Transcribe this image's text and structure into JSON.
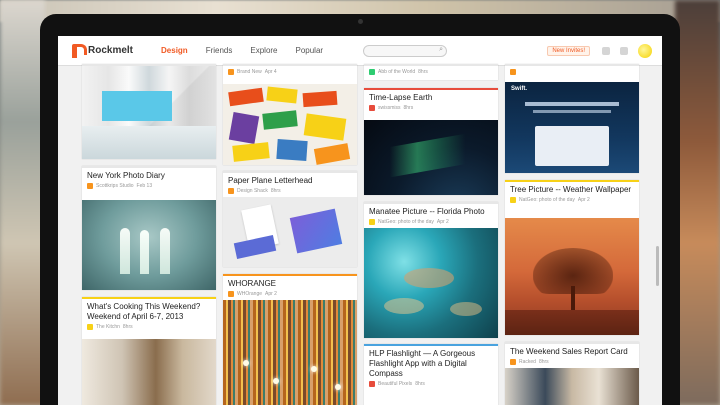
{
  "nav": {
    "brand": "Rockmelt",
    "links": [
      "Design",
      "Friends",
      "Explore",
      "Popular"
    ],
    "active": "Design",
    "invites": "New Invites!"
  },
  "cards": {
    "brandnew": {
      "meta_source": "Brand New",
      "meta_time": "Apr 4"
    },
    "artworld": {
      "meta_source": "Abb of the World",
      "meta_time": "8hrs"
    },
    "swift": {
      "image_text": "Swift."
    },
    "timelapse": {
      "title": "Time-Lapse Earth",
      "meta_source": "swissmiss",
      "meta_time": "8hrs"
    },
    "nyphoto": {
      "title": "New York Photo Diary",
      "meta_source": "Scottkrips Studio",
      "meta_time": "Feb 13"
    },
    "letterhead": {
      "title": "Paper Plane Letterhead",
      "meta_source": "Design Shack",
      "meta_time": "8hrs"
    },
    "tree": {
      "title": "Tree Picture -- Weather Wallpaper",
      "meta_source": "NatGeo: photo of the day",
      "meta_time": "Apr 2"
    },
    "manatee": {
      "title": "Manatee Picture -- Florida Photo",
      "meta_source": "NatGeo: photo of the day",
      "meta_time": "Apr 2"
    },
    "whorange": {
      "title": "WHORANGE",
      "meta_source": "WHOrange",
      "meta_time": "Apr 2"
    },
    "cooking": {
      "title": "What's Cooking This Weekend? Weekend of April 6-7, 2013",
      "meta_source": "The Kitchn",
      "meta_time": "8hrs"
    },
    "sales": {
      "title": "The Weekend Sales Report Card",
      "meta_source": "Racked",
      "meta_time": "8hrs"
    },
    "hlp": {
      "title": "HLP Flashlight — A Gorgeous Flashlight App with a Digital Compass",
      "meta_source": "Beautiful Pixels",
      "meta_time": "8hrs"
    }
  }
}
